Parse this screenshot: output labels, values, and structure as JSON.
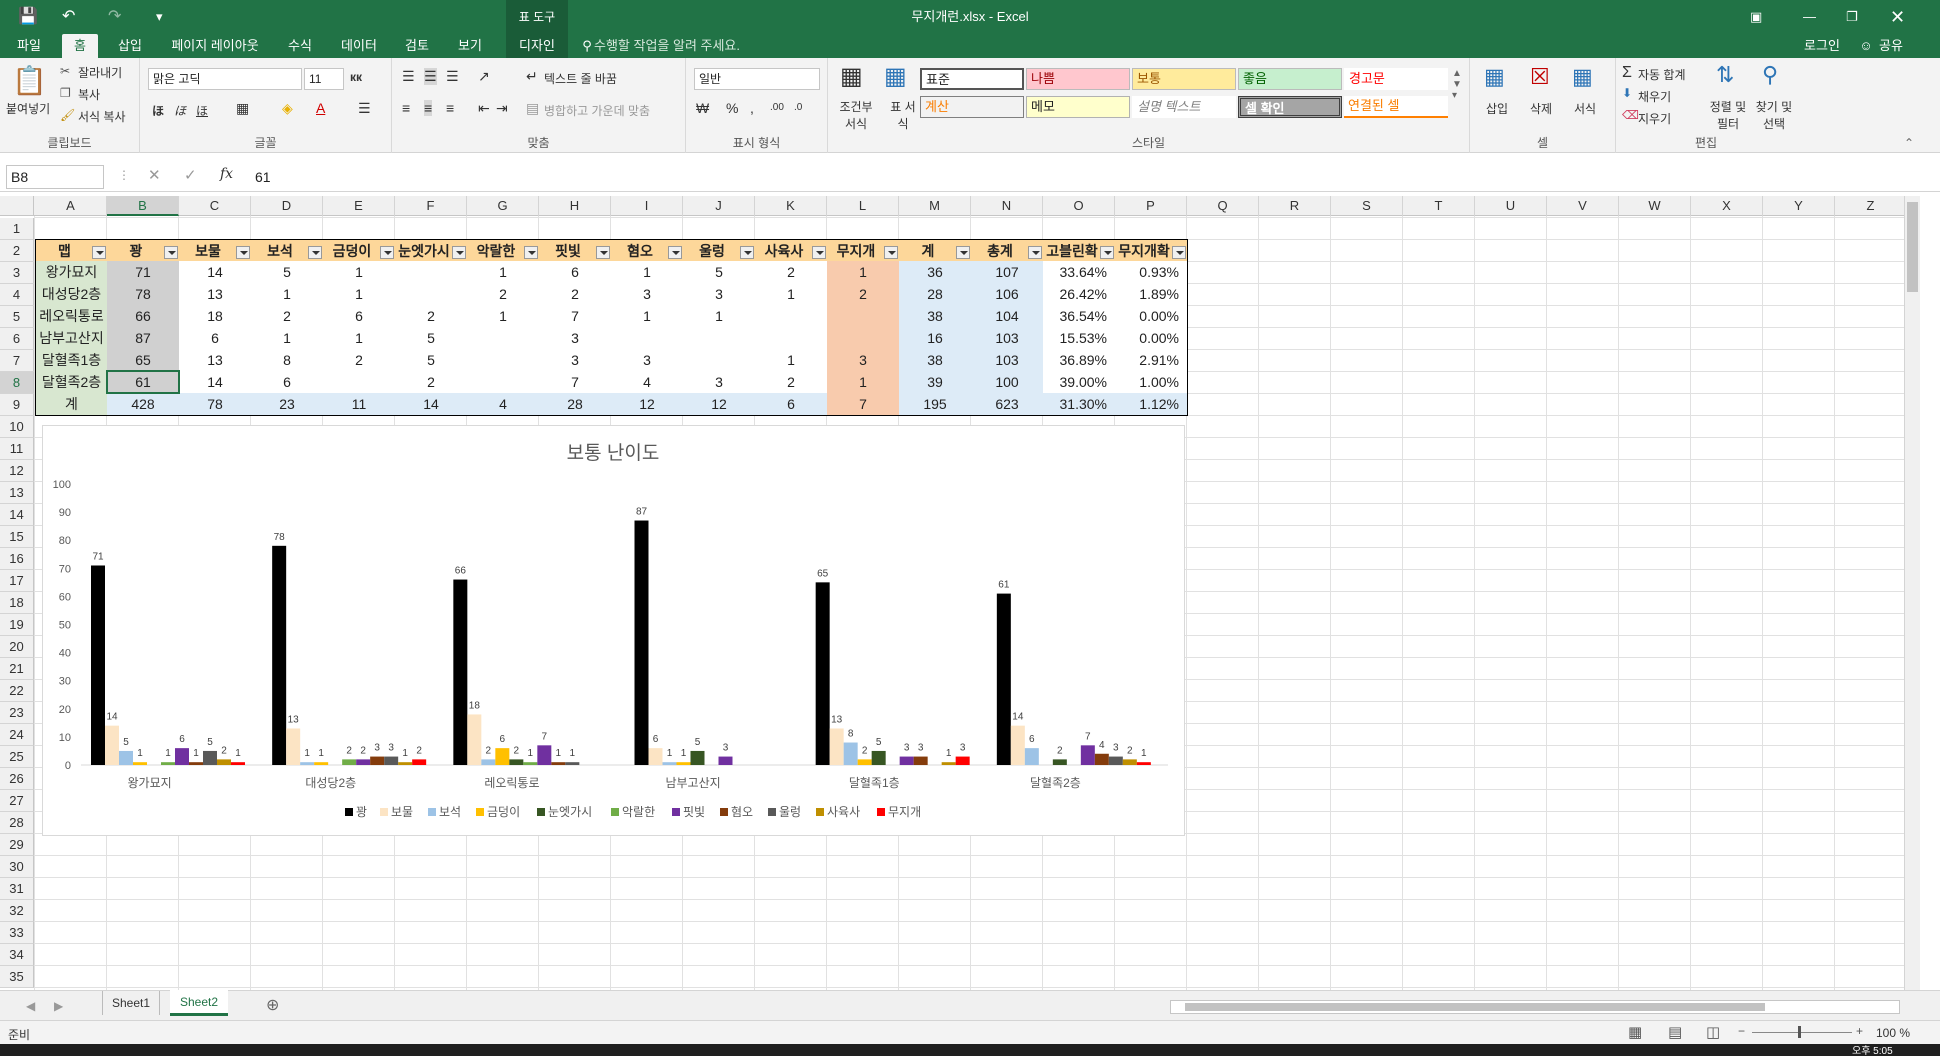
{
  "window": {
    "title": "무지개런.xlsx - Excel",
    "tools_label": "표 도구",
    "login": "로그인",
    "share": "공유"
  },
  "tabs": [
    "파일",
    "홈",
    "삽입",
    "페이지 레이아웃",
    "수식",
    "데이터",
    "검토",
    "보기",
    "디자인"
  ],
  "tell_me": "수행할 작업을 알려 주세요.",
  "ribbon": {
    "clipboard": {
      "paste": "붙여넣기",
      "cut": "잘라내기",
      "copy": "복사",
      "format_painter": "서식 복사",
      "label": "클립보드"
    },
    "font": {
      "name": "맑은 고딕",
      "size": "11",
      "label": "글꼴"
    },
    "align": {
      "wrap": "텍스트 줄 바꿈",
      "merge": "병합하고 가운데 맞춤",
      "label": "맞춤"
    },
    "number": {
      "format": "일반",
      "label": "표시 형식"
    },
    "styles": {
      "conditional": "조건부 서식",
      "table": "표 서식",
      "label": "스타일",
      "cells": [
        "표준",
        "나쁨",
        "보통",
        "좋음",
        "경고문",
        "계산",
        "메모",
        "설명 텍스트",
        "셀 확인",
        "연결된 셀"
      ]
    },
    "cells_group": {
      "insert": "삽입",
      "delete": "삭제",
      "format": "서식",
      "label": "셀"
    },
    "editing": {
      "autosum": "자동 합계",
      "fill": "채우기",
      "clear": "지우기",
      "sort": "정렬 및 필터",
      "find": "찾기 및 선택",
      "label": "편집"
    }
  },
  "formula_bar": {
    "name_box": "B8",
    "value": "61"
  },
  "columns": [
    "A",
    "B",
    "C",
    "D",
    "E",
    "F",
    "G",
    "H",
    "I",
    "J",
    "K",
    "L",
    "M",
    "N",
    "O",
    "P",
    "Q",
    "R",
    "S",
    "T",
    "U",
    "V",
    "W",
    "X",
    "Y",
    "Z"
  ],
  "rows": [
    "1",
    "2",
    "3",
    "4",
    "5",
    "6",
    "7",
    "8",
    "9",
    "10",
    "11",
    "12",
    "13",
    "14",
    "15",
    "16",
    "17",
    "18",
    "19",
    "20",
    "21",
    "22",
    "23",
    "24",
    "25",
    "26",
    "27",
    "28",
    "29",
    "30",
    "31",
    "32",
    "33",
    "34",
    "35"
  ],
  "table": {
    "headers": [
      "맵",
      "꽝",
      "보물",
      "보석",
      "금덩이",
      "눈엣가시",
      "악랄한",
      "핏빛",
      "혐오",
      "울렁",
      "사육사",
      "무지개",
      "계",
      "총계",
      "고블린확",
      "무지개확"
    ],
    "rows": [
      [
        "왕가묘지",
        "71",
        "14",
        "5",
        "1",
        "",
        "1",
        "6",
        "1",
        "5",
        "2",
        "1",
        "36",
        "107",
        "33.64%",
        "0.93%"
      ],
      [
        "대성당2층",
        "78",
        "13",
        "1",
        "1",
        "",
        "2",
        "2",
        "3",
        "3",
        "1",
        "2",
        "28",
        "106",
        "26.42%",
        "1.89%"
      ],
      [
        "레오릭통로",
        "66",
        "18",
        "2",
        "6",
        "2",
        "1",
        "7",
        "1",
        "1",
        "",
        "",
        "38",
        "104",
        "36.54%",
        "0.00%"
      ],
      [
        "남부고산지",
        "87",
        "6",
        "1",
        "1",
        "5",
        "",
        "3",
        "",
        "",
        "",
        "",
        "16",
        "103",
        "15.53%",
        "0.00%"
      ],
      [
        "달혈족1층",
        "65",
        "13",
        "8",
        "2",
        "5",
        "",
        "3",
        "3",
        "",
        "1",
        "3",
        "38",
        "103",
        "36.89%",
        "2.91%"
      ],
      [
        "달혈족2층",
        "61",
        "14",
        "6",
        "",
        "2",
        "",
        "7",
        "4",
        "3",
        "2",
        "1",
        "39",
        "100",
        "39.00%",
        "1.00%"
      ]
    ],
    "total": [
      "계",
      "428",
      "78",
      "23",
      "11",
      "14",
      "4",
      "28",
      "12",
      "12",
      "6",
      "7",
      "195",
      "623",
      "31.30%",
      "1.12%"
    ]
  },
  "chart_data": {
    "type": "bar",
    "title": "보통 난이도",
    "categories": [
      "왕가묘지",
      "대성당2층",
      "레오릭통로",
      "남부고산지",
      "달혈족1층",
      "달혈족2층"
    ],
    "ylim": [
      0,
      100
    ],
    "yticks": [
      0,
      10,
      20,
      30,
      40,
      50,
      60,
      70,
      80,
      90,
      100
    ],
    "grid": false,
    "legend": "bottom",
    "series": [
      {
        "name": "꽝",
        "color": "#000000",
        "values": [
          71,
          78,
          66,
          87,
          65,
          61
        ]
      },
      {
        "name": "보물",
        "color": "#fce4c4",
        "values": [
          14,
          13,
          18,
          6,
          13,
          14
        ]
      },
      {
        "name": "보석",
        "color": "#9dc3e6",
        "values": [
          5,
          1,
          2,
          1,
          8,
          6
        ]
      },
      {
        "name": "금덩이",
        "color": "#ffc000",
        "values": [
          1,
          1,
          6,
          1,
          2,
          null
        ]
      },
      {
        "name": "눈엣가시",
        "color": "#375623",
        "values": [
          null,
          null,
          2,
          5,
          5,
          2
        ]
      },
      {
        "name": "악랄한",
        "color": "#70ad47",
        "values": [
          1,
          2,
          1,
          null,
          null,
          null
        ]
      },
      {
        "name": "핏빛",
        "color": "#7030a0",
        "values": [
          6,
          2,
          7,
          3,
          3,
          7
        ]
      },
      {
        "name": "혐오",
        "color": "#843c0c",
        "values": [
          1,
          3,
          1,
          null,
          3,
          4
        ]
      },
      {
        "name": "울렁",
        "color": "#595959",
        "values": [
          5,
          3,
          1,
          null,
          null,
          3
        ]
      },
      {
        "name": "사육사",
        "color": "#bf8f00",
        "values": [
          2,
          1,
          null,
          null,
          1,
          2
        ]
      },
      {
        "name": "무지개",
        "color": "#ff0000",
        "values": [
          1,
          2,
          null,
          null,
          3,
          1
        ]
      }
    ]
  },
  "sheets": [
    "Sheet1",
    "Sheet2"
  ],
  "status": {
    "ready": "준비",
    "zoom": "100 %"
  },
  "taskbar": {
    "time": "오후 5:05"
  }
}
